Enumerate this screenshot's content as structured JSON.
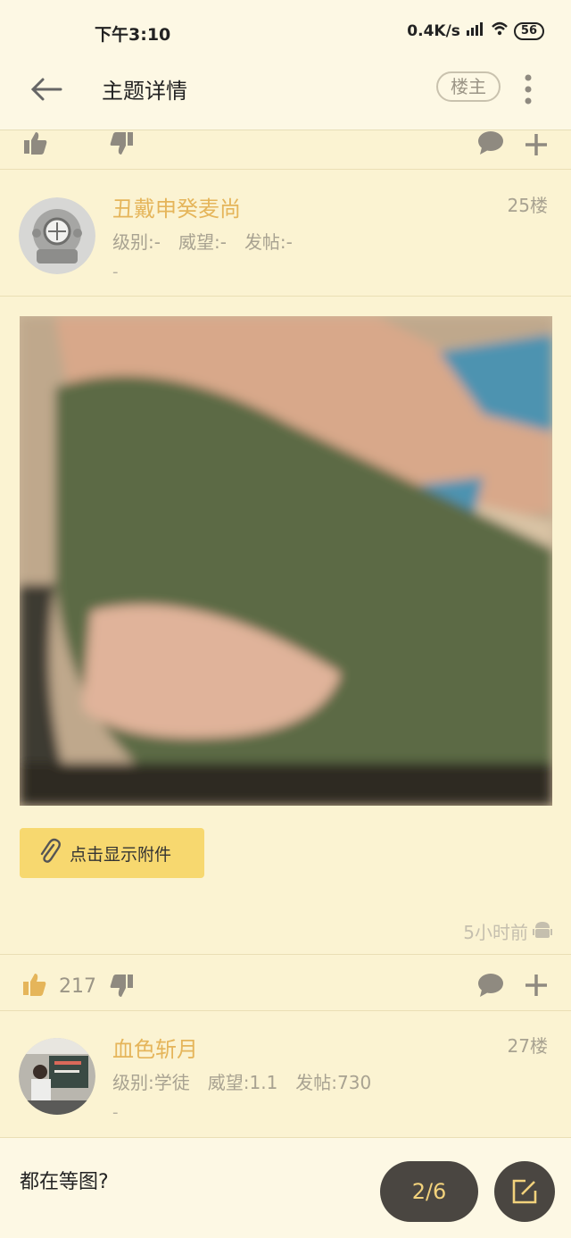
{
  "status_bar": {
    "time": "下午3:10",
    "network_speed": "0.4K/s",
    "battery": "56"
  },
  "header": {
    "title": "主题详情",
    "louzhu_label": "楼主"
  },
  "posts": [
    {
      "username": "丑戴申癸麦尚",
      "floor": "25楼",
      "level": "级别:-",
      "prestige": "威望:-",
      "posts": "发帖:-",
      "signature": "-",
      "attachment_label": "点击显示附件",
      "time": "5小时前",
      "likes": "217"
    },
    {
      "username": "血色斩月",
      "floor": "27楼",
      "level": "级别:学徒",
      "prestige": "威望:1.1",
      "posts": "发帖:730",
      "signature": "-"
    }
  ],
  "bottom": {
    "preview_text": "都在等图?",
    "page_indicator": "2/6"
  },
  "colors": {
    "background": "#FBF3D2",
    "accent_username": "#E5B55A",
    "attach_button": "#F7D86F",
    "fab": "#4A4641"
  }
}
